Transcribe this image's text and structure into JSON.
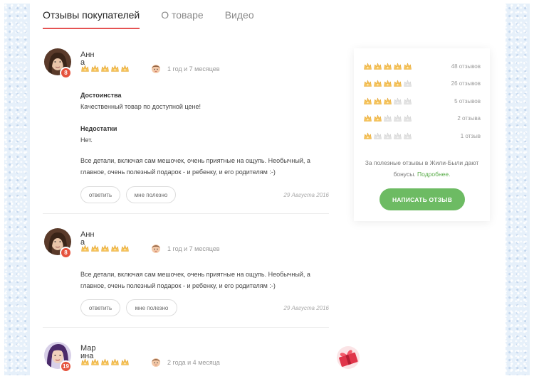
{
  "tabs": [
    {
      "label": "Отзывы покупателей",
      "active": true
    },
    {
      "label": "О товаре",
      "active": false
    },
    {
      "label": "Видео",
      "active": false
    }
  ],
  "reviews": [
    {
      "author": "Анна",
      "badge": "8",
      "rating": 5,
      "child_age": "1 год и 7 месяцев",
      "pros_title": "Достоинства",
      "pros": "Качественный товар по доступной цене!",
      "cons_title": "Недостатки",
      "cons": "Нет.",
      "comment": "Все детали, включая сам мешочек, очень приятные на ощупь. Необычный, а главное, очень полезный подарок - и ребенку, и его родителям :-)",
      "reply_label": "ответить",
      "helpful_label": "мне полезно",
      "date": "29 Августа 2016"
    },
    {
      "author": "Анна",
      "badge": "8",
      "rating": 5,
      "child_age": "1 год и 7 месяцев",
      "comment": "Все детали, включая сам мешочек, очень приятные на ощупь. Необычный, а главное, очень полезный подарок - и ребенку, и его родителям :-)",
      "reply_label": "ответить",
      "helpful_label": "мне полезно",
      "date": "29 Августа 2016"
    },
    {
      "author": "Марина",
      "badge": "19",
      "rating": 5,
      "child_age": "2 года и 4 месяца"
    }
  ],
  "rating_summary": {
    "rows": [
      {
        "stars": 5,
        "count_label": "48 отзывов"
      },
      {
        "stars": 4,
        "count_label": "26 отзывов"
      },
      {
        "stars": 3,
        "count_label": "5 отзывов"
      },
      {
        "stars": 2,
        "count_label": "2 отзыва"
      },
      {
        "stars": 1,
        "count_label": "1 отзыв"
      }
    ],
    "bonus_text": "За полезные отзывы в Жили-Были дают бонусы.",
    "bonus_link": "Подробнее.",
    "write_button": "НАПИСАТЬ ОТЗЫВ"
  },
  "colors": {
    "accent_red": "#e55353",
    "star_filled": "#f6c35a",
    "star_empty": "#e3e3e3",
    "button_green": "#6dbb63",
    "link_green": "#5aad4a"
  }
}
